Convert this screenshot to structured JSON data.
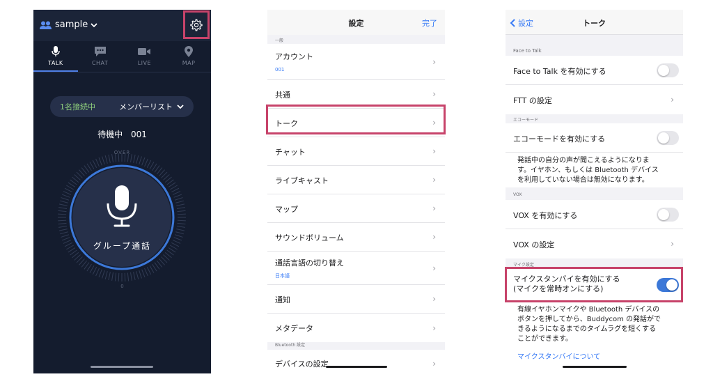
{
  "talk_screen": {
    "channel_name": "sample",
    "tabs": [
      {
        "label": "TALK",
        "icon": "mic-icon",
        "active": true
      },
      {
        "label": "CHAT",
        "icon": "chat-icon",
        "active": false
      },
      {
        "label": "LIVE",
        "icon": "video-icon",
        "active": false
      },
      {
        "label": "MAP",
        "icon": "map-pin-icon",
        "active": false
      }
    ],
    "connected_count": "1名接続中",
    "member_list_label": "メンバーリスト",
    "status_text": "待機中",
    "status_id": "001",
    "over_label": "OVER",
    "zero_label": "0",
    "talk_button_label": "グループ通話",
    "colors": {
      "background": "#141c2e",
      "accent": "#4f7fe6",
      "highlight": "#c7436a"
    }
  },
  "settings_screen": {
    "title": "設定",
    "done_label": "完了",
    "section_general": "一般",
    "account_label": "アカウント",
    "account_value": "001",
    "common_label": "共通",
    "talk_label": "トーク",
    "chat_label": "チャット",
    "livecast_label": "ライブキャスト",
    "map_label": "マップ",
    "sound_volume_label": "サウンドボリューム",
    "language_label": "通話言語の切り替え",
    "language_value": "日本語",
    "notification_label": "通知",
    "metadata_label": "メタデータ",
    "section_bluetooth": "Bluetooth 設定",
    "device_settings_label": "デバイスの設定"
  },
  "talk_settings_screen": {
    "back_label": "設定",
    "title": "トーク",
    "section_ftt": "Face to Talk",
    "ftt_enable_label": "Face to Talk を有効にする",
    "ftt_enable_on": false,
    "ftt_settings_label": "FTT の設定",
    "section_echo": "エコーモード",
    "echo_enable_label": "エコーモードを有効にする",
    "echo_enable_on": false,
    "echo_desc_1": "発話中の自分の声が聞こえるようになりま",
    "echo_desc_2": "す。イヤホン、もしくは Bluetooth デバイス",
    "echo_desc_3": "を利用していない場合は無効になります。",
    "section_vox": "VOX",
    "vox_enable_label": "VOX を有効にする",
    "vox_enable_on": false,
    "vox_settings_label": "VOX の設定",
    "section_mic": "マイク設定",
    "mic_standby_label_1": "マイクスタンバイを有効にする",
    "mic_standby_label_2": "(マイクを常時オンにする)",
    "mic_standby_on": true,
    "mic_desc_1": "有線イヤホンマイクや Bluetooth デバイスの",
    "mic_desc_2": "ボタンを押してから、Buddycom の発話がで",
    "mic_desc_3": "きるようになるまでのタイムラグを短くする",
    "mic_desc_4": "ことができます。",
    "mic_standby_link": "マイクスタンバイについて",
    "colors": {
      "toggle_on": "#3c78d8",
      "link": "#3478f6"
    }
  }
}
